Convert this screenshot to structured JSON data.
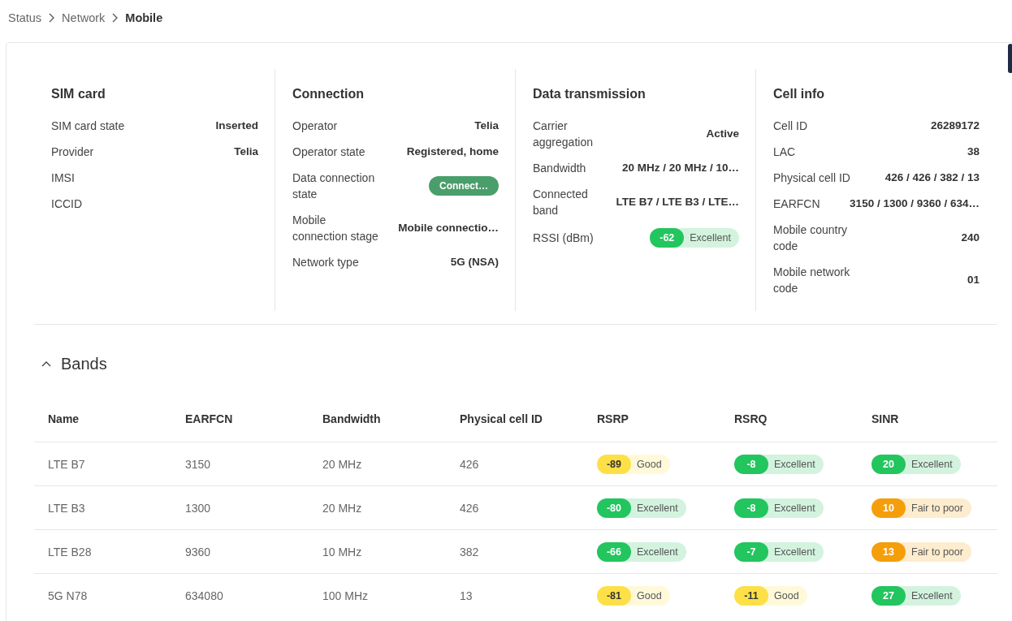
{
  "breadcrumb": [
    {
      "label": "Status",
      "current": false
    },
    {
      "label": "Network",
      "current": false
    },
    {
      "label": "Mobile",
      "current": true
    }
  ],
  "sections": [
    {
      "title": "SIM card",
      "rows": [
        {
          "label": "SIM card state",
          "kind": "text",
          "value": "Inserted"
        },
        {
          "label": "Provider",
          "kind": "text",
          "value": "Telia"
        },
        {
          "label": "IMSI",
          "kind": "empty"
        },
        {
          "label": "ICCID",
          "kind": "empty"
        }
      ]
    },
    {
      "title": "Connection",
      "rows": [
        {
          "label": "Operator",
          "kind": "text",
          "value": "Telia"
        },
        {
          "label": "Operator state",
          "kind": "text",
          "value": "Registered, home"
        },
        {
          "label": "Data connection state",
          "kind": "pill",
          "value": "Connect…"
        },
        {
          "label": "Mobile connection stage",
          "kind": "text",
          "value": "Mobile connectio…"
        },
        {
          "label": "Network type",
          "kind": "text",
          "value": "5G (NSA)"
        }
      ]
    },
    {
      "title": "Data transmission",
      "rows": [
        {
          "label": "Carrier aggregation",
          "kind": "text",
          "value": "Active"
        },
        {
          "label": "Bandwidth",
          "kind": "text",
          "value": "20 MHz / 20 MHz / 10…"
        },
        {
          "label": "Connected band",
          "kind": "text",
          "value": "LTE B7 / LTE B3 / LTE…"
        },
        {
          "label": "RSSI (dBm)",
          "kind": "signal",
          "value": "-62",
          "quality": "Excellent",
          "color": "#22c55e"
        }
      ]
    },
    {
      "title": "Cell info",
      "rows": [
        {
          "label": "Cell ID",
          "kind": "text",
          "value": "26289172"
        },
        {
          "label": "LAC",
          "kind": "text",
          "value": "38"
        },
        {
          "label": "Physical cell ID",
          "kind": "text",
          "value": "426 / 426 / 382 / 13"
        },
        {
          "label": "EARFCN",
          "kind": "text",
          "value": "3150 / 1300 / 9360 / 634…"
        },
        {
          "label": "Mobile country code",
          "kind": "text",
          "value": "240"
        },
        {
          "label": "Mobile network code",
          "kind": "text",
          "value": "01"
        }
      ]
    }
  ],
  "bands": {
    "title": "Bands",
    "expanded": true,
    "columns": [
      "Name",
      "EARFCN",
      "Bandwidth",
      "Physical cell ID",
      "RSRP",
      "RSRQ",
      "SINR"
    ],
    "rows": [
      {
        "name": "LTE B7",
        "earfcn": "3150",
        "bandwidth": "20 MHz",
        "pci": "426",
        "signals": [
          {
            "value": "-89",
            "quality": "Good",
            "color": "#fde047"
          },
          {
            "value": "-8",
            "quality": "Excellent",
            "color": "#22c55e"
          },
          {
            "value": "20",
            "quality": "Excellent",
            "color": "#22c55e"
          }
        ]
      },
      {
        "name": "LTE B3",
        "earfcn": "1300",
        "bandwidth": "20 MHz",
        "pci": "426",
        "signals": [
          {
            "value": "-80",
            "quality": "Excellent",
            "color": "#22c55e"
          },
          {
            "value": "-8",
            "quality": "Excellent",
            "color": "#22c55e"
          },
          {
            "value": "10",
            "quality": "Fair to poor",
            "color": "#f59e0b"
          }
        ]
      },
      {
        "name": "LTE B28",
        "earfcn": "9360",
        "bandwidth": "10 MHz",
        "pci": "382",
        "signals": [
          {
            "value": "-66",
            "quality": "Excellent",
            "color": "#22c55e"
          },
          {
            "value": "-7",
            "quality": "Excellent",
            "color": "#22c55e"
          },
          {
            "value": "13",
            "quality": "Fair to poor",
            "color": "#f59e0b"
          }
        ]
      },
      {
        "name": "5G N78",
        "earfcn": "634080",
        "bandwidth": "100 MHz",
        "pci": "13",
        "signals": [
          {
            "value": "-81",
            "quality": "Good",
            "color": "#fde047"
          },
          {
            "value": "-11",
            "quality": "Good",
            "color": "#fde047"
          },
          {
            "value": "27",
            "quality": "Excellent",
            "color": "#22c55e"
          }
        ]
      }
    ]
  }
}
